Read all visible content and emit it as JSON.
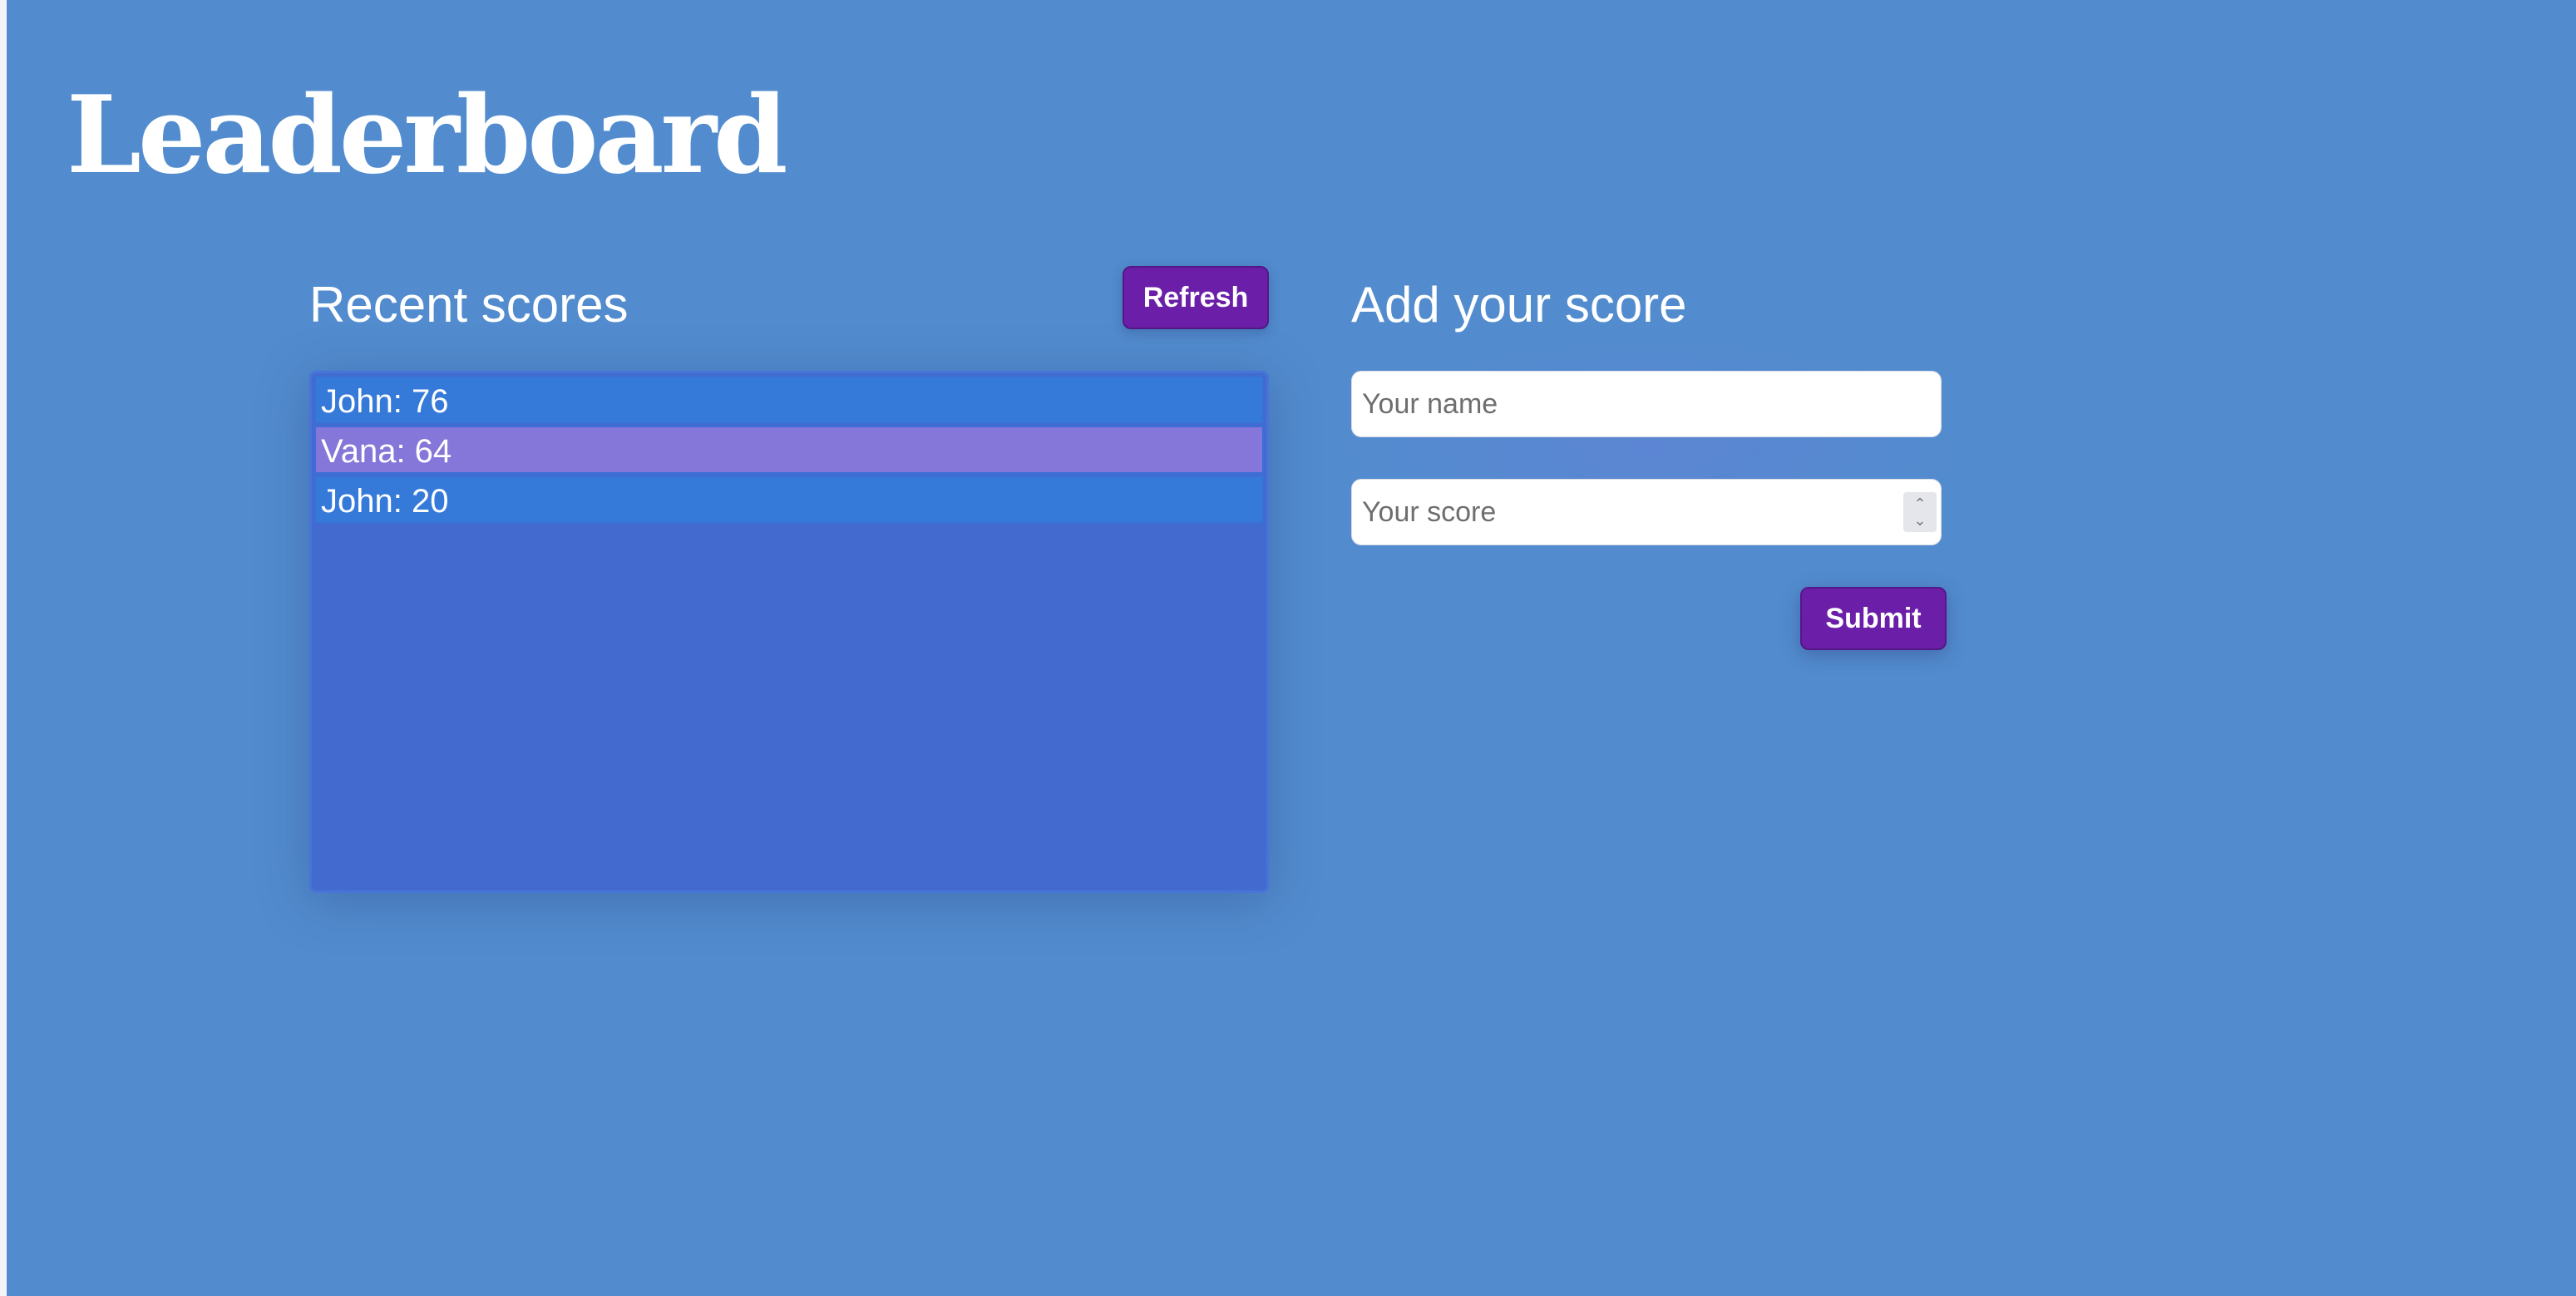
{
  "page": {
    "title": "Leaderboard"
  },
  "scores": {
    "heading": "Recent scores",
    "refresh_label": "Refresh",
    "items": [
      {
        "text": "John: 76"
      },
      {
        "text": "Vana: 64"
      },
      {
        "text": "John: 20"
      }
    ]
  },
  "add_score": {
    "heading": "Add your score",
    "name_placeholder": "Your name",
    "score_placeholder": "Your score",
    "submit_label": "Submit"
  },
  "colors": {
    "background": "#528cce",
    "list_background": "#436bcf",
    "item_blue": "#367ad9",
    "item_purple": "#8576d9",
    "button": "#6b1fa8"
  }
}
